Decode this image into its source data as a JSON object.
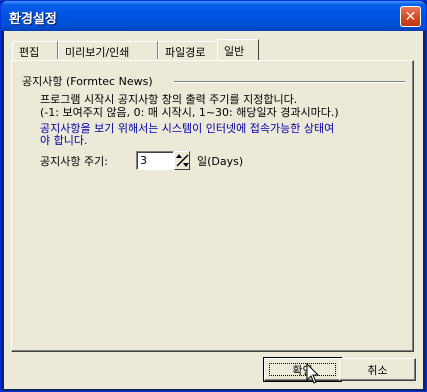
{
  "window": {
    "title": "환경설정"
  },
  "tabs": [
    {
      "label": "편집"
    },
    {
      "label": "미리보기/인쇄"
    },
    {
      "label": "파일경로"
    },
    {
      "label": "일반"
    }
  ],
  "group": {
    "label": "공지사항 (Formtec News)",
    "desc_line1": "프로그램 시작시 공지사항 창의 출력 주기를 지정합니다.",
    "desc_line2": "(-1: 보여주지 않음, 0: 매 시작시, 1~30: 해당일자 경과시마다.)",
    "note_line1": "공지사항을 보기 위해서는 시스템이 인터넷에 접속가능한 상태여",
    "note_line2": "야 합니다.",
    "field_label": "공지사항 주기:",
    "field_value": "3",
    "field_unit": "일(Days)"
  },
  "buttons": {
    "ok": "확인",
    "cancel": "취소"
  },
  "colors": {
    "titlebar": "#0054e3",
    "note_text": "#0000a8",
    "face": "#ece9d8"
  }
}
